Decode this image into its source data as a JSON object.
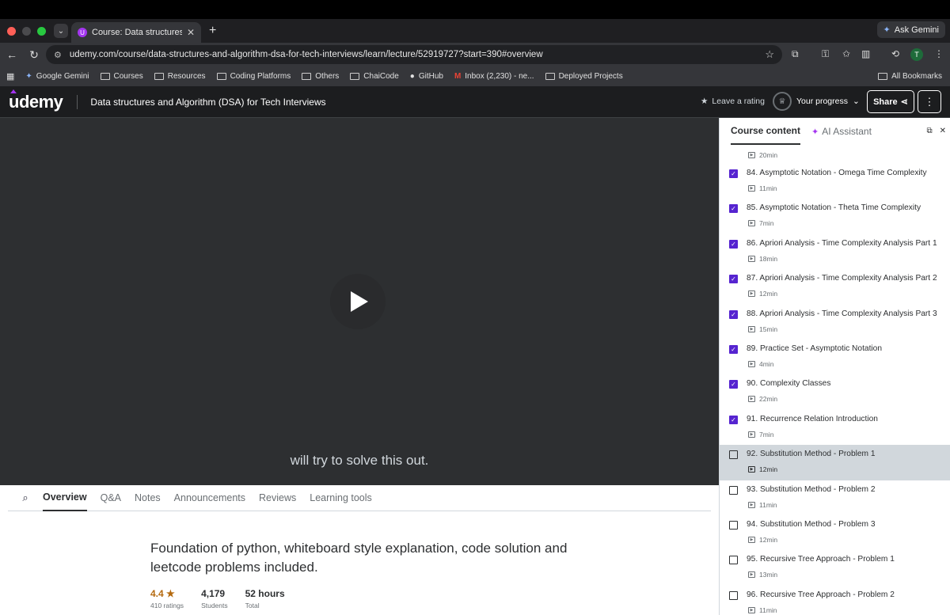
{
  "browser": {
    "tab_title": "Course: Data structures and A",
    "ask_gemini": "Ask Gemini",
    "url": "udemy.com/course/data-structures-and-algorithm-dsa-for-tech-interviews/learn/lecture/52919727?start=390#overview",
    "profile_initial": "T",
    "bookmarks": [
      "Google Gemini",
      "Courses",
      "Resources",
      "Coding Platforms",
      "Others",
      "ChaiCode",
      "GitHub",
      "Inbox (2,230) - ne...",
      "Deployed Projects"
    ],
    "all_bookmarks": "All Bookmarks"
  },
  "header": {
    "logo": "udemy",
    "course_title": "Data structures and Algorithm (DSA) for Tech Interviews",
    "leave_rating": "Leave a rating",
    "progress": "Your progress",
    "share": "Share",
    "more": "⋮"
  },
  "video": {
    "caption": "will try to solve this out."
  },
  "lower": {
    "tabs": [
      "Overview",
      "Q&A",
      "Notes",
      "Announcements",
      "Reviews",
      "Learning tools"
    ],
    "active_tab": "Overview",
    "headline": "Foundation of python, whiteboard style explanation, code solution and leetcode problems included.",
    "rating_value": "4.4",
    "rating_label": "410 ratings",
    "students_value": "4,179",
    "students_label": "Students",
    "hours_value": "52 hours",
    "hours_label": "Total"
  },
  "sidebar": {
    "tab_content": "Course content",
    "tab_ai": "AI Assistant",
    "first_duration": "20min",
    "lectures": [
      {
        "title": "84. Asymptotic Notation - Omega Time Complexity",
        "duration": "11min",
        "done": true
      },
      {
        "title": "85. Asymptotic Notation - Theta Time Complexity",
        "duration": "7min",
        "done": true
      },
      {
        "title": "86. Apriori Analysis - Time Complexity Analysis Part 1",
        "duration": "18min",
        "done": true
      },
      {
        "title": "87. Apriori Analysis - Time Complexity Analysis Part 2",
        "duration": "12min",
        "done": true
      },
      {
        "title": "88. Apriori Analysis - Time Complexity Analysis Part 3",
        "duration": "15min",
        "done": true
      },
      {
        "title": "89. Practice Set - Asymptotic Notation",
        "duration": "4min",
        "done": true
      },
      {
        "title": "90. Complexity Classes",
        "duration": "22min",
        "done": true
      },
      {
        "title": "91. Recurrence Relation Introduction",
        "duration": "7min",
        "done": true
      },
      {
        "title": "92. Substitution Method - Problem 1",
        "duration": "12min",
        "done": false,
        "current": true
      },
      {
        "title": "93. Substitution Method - Problem 2",
        "duration": "11min",
        "done": false
      },
      {
        "title": "94. Substitution Method - Problem 3",
        "duration": "12min",
        "done": false
      },
      {
        "title": "95. Recursive Tree Approach - Problem 1",
        "duration": "13min",
        "done": false
      },
      {
        "title": "96. Recursive Tree Approach - Problem 2",
        "duration": "11min",
        "done": false
      }
    ]
  },
  "colors": {
    "brand": "#a435f0",
    "checkbox": "#5624d0",
    "current_row": "#d1d7dc",
    "star": "#b4690e"
  }
}
